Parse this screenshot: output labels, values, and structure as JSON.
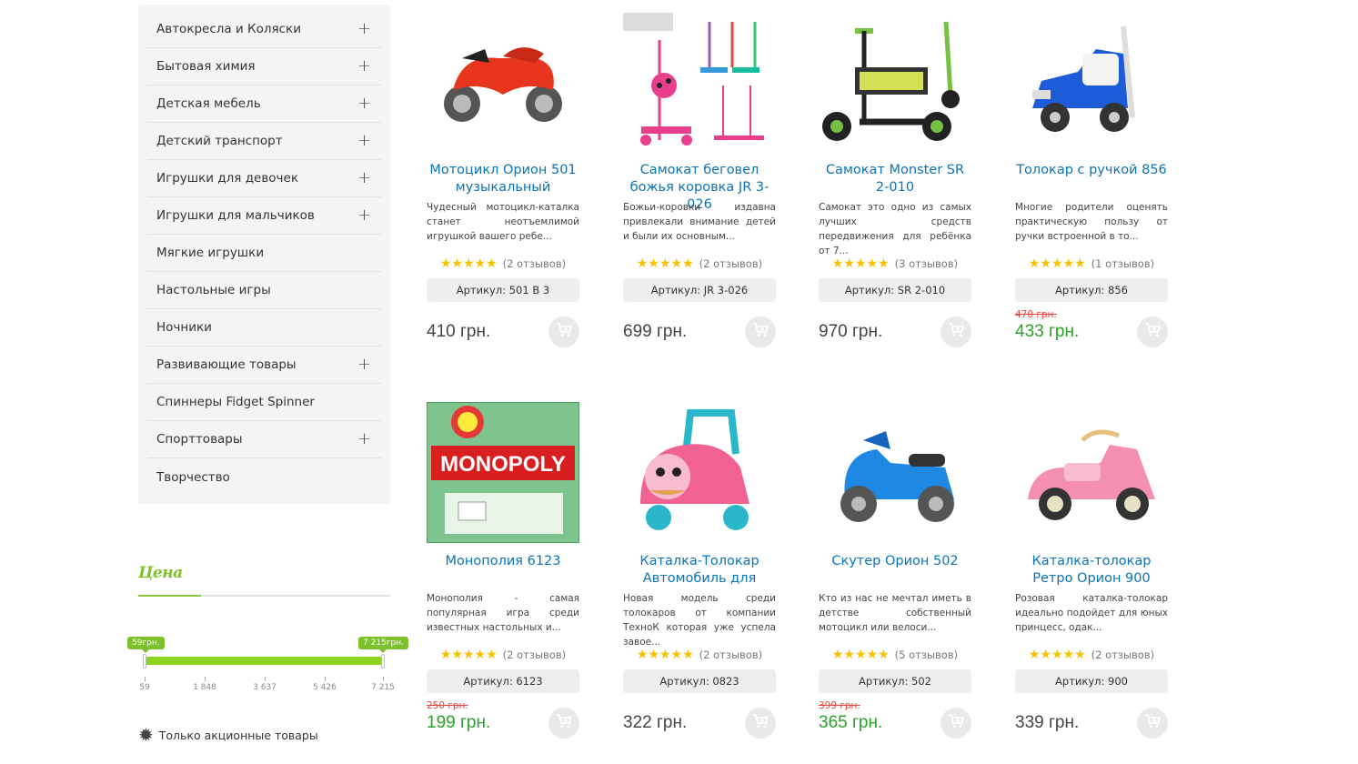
{
  "sidebar": {
    "categories": [
      {
        "label": "Автокресла и Коляски",
        "expandable": true
      },
      {
        "label": "Бытовая химия",
        "expandable": true
      },
      {
        "label": "Детская мебель",
        "expandable": true
      },
      {
        "label": "Детский транспорт",
        "expandable": true
      },
      {
        "label": "Игрушки для девочек",
        "expandable": true
      },
      {
        "label": "Игрушки для мальчиков",
        "expandable": true
      },
      {
        "label": "Мягкие игрушки",
        "expandable": false
      },
      {
        "label": "Настольные игры",
        "expandable": false
      },
      {
        "label": "Ночники",
        "expandable": false
      },
      {
        "label": "Развивающие товары",
        "expandable": true
      },
      {
        "label": "Спиннеры Fidget Spinner",
        "expandable": false
      },
      {
        "label": "Спорттовары",
        "expandable": true
      },
      {
        "label": "Творчество",
        "expandable": false
      }
    ],
    "plus_symbol": "+"
  },
  "price_filter": {
    "title": "Цена",
    "min_label": "59грн.",
    "max_label": "7 215грн.",
    "ticks": [
      "59",
      "1 848",
      "3 637",
      "5 426",
      "7 215"
    ],
    "promo_label": "Только акционные товары",
    "accent_color": "#7cc02a"
  },
  "products": [
    {
      "name": "Мотоцикл Орион 501 музыкальный",
      "desc": "Чудесный мотоцикл-каталка станет неотъемлимой игрушкой вашего ребе...",
      "reviews": "(2 отзывов)",
      "sku": "Артикул: 501 В 3",
      "old_price": "",
      "price": "410 грн.",
      "sale": false,
      "image": "red-motorcycle"
    },
    {
      "name": "Самокат беговел божья коровка JR 3-026",
      "desc": "Божьи-коровки издавна привлекали внимание детей и были их основным...",
      "reviews": "(2 отзывов)",
      "sku": "Артикул: JR 3-026",
      "old_price": "",
      "price": "699 грн.",
      "sale": false,
      "image": "ladybug-scooters"
    },
    {
      "name": "Самокат Monster SR 2-010",
      "desc": "Самокат это одно из самых лучших средств передвижения для ребёнка от 7...",
      "reviews": "(3 отзывов)",
      "sku": "Артикул: SR 2-010",
      "old_price": "",
      "price": "970 грн.",
      "sale": false,
      "image": "green-scooter"
    },
    {
      "name": "Толокар с ручкой 856",
      "desc": "Многие родители оценять практическую пользу от ручки встроенной в то...",
      "reviews": "(1 отзывов)",
      "sku": "Артикул: 856",
      "old_price": "470 грн.",
      "price": "433 грн.",
      "sale": true,
      "image": "blue-ride-on"
    },
    {
      "name": "Монополия 6123",
      "desc": "Монополия - самая популярная игра среди известных настольных и...",
      "reviews": "(2 отзывов)",
      "sku": "Артикул: 6123",
      "old_price": "250 грн.",
      "price": "199 грн.",
      "sale": true,
      "image": "monopoly-box"
    },
    {
      "name": "Каталка-Толокар Автомобиль для",
      "desc": "Новая модель среди толокаров от компании ТехноК которая уже успела завое...",
      "reviews": "(2 отзывов)",
      "sku": "Артикул: 0823",
      "old_price": "",
      "price": "322 грн.",
      "sale": false,
      "image": "pink-puppy-car"
    },
    {
      "name": "Скутер Орион 502",
      "desc": "Кто из нас не мечтал иметь в детстве собственный мотоцикл или велоси...",
      "reviews": "(5 отзывов)",
      "sku": "Артикул: 502",
      "old_price": "399 грн.",
      "price": "365 грн.",
      "sale": true,
      "image": "blue-scooter"
    },
    {
      "name": "Каталка-толокар Ретро Орион 900",
      "desc": "Розовая каталка-толокар идеально подойдет для юных принцесс, одак...",
      "reviews": "(2 отзывов)",
      "sku": "Артикул: 900",
      "old_price": "",
      "price": "339 грн.",
      "sale": false,
      "image": "pink-retro-car"
    }
  ],
  "stars": "★★★★★",
  "colors": {
    "link": "#0b73b6",
    "sale_price": "#2aa12a",
    "old_price": "#e2453c",
    "star": "#f5c200"
  }
}
